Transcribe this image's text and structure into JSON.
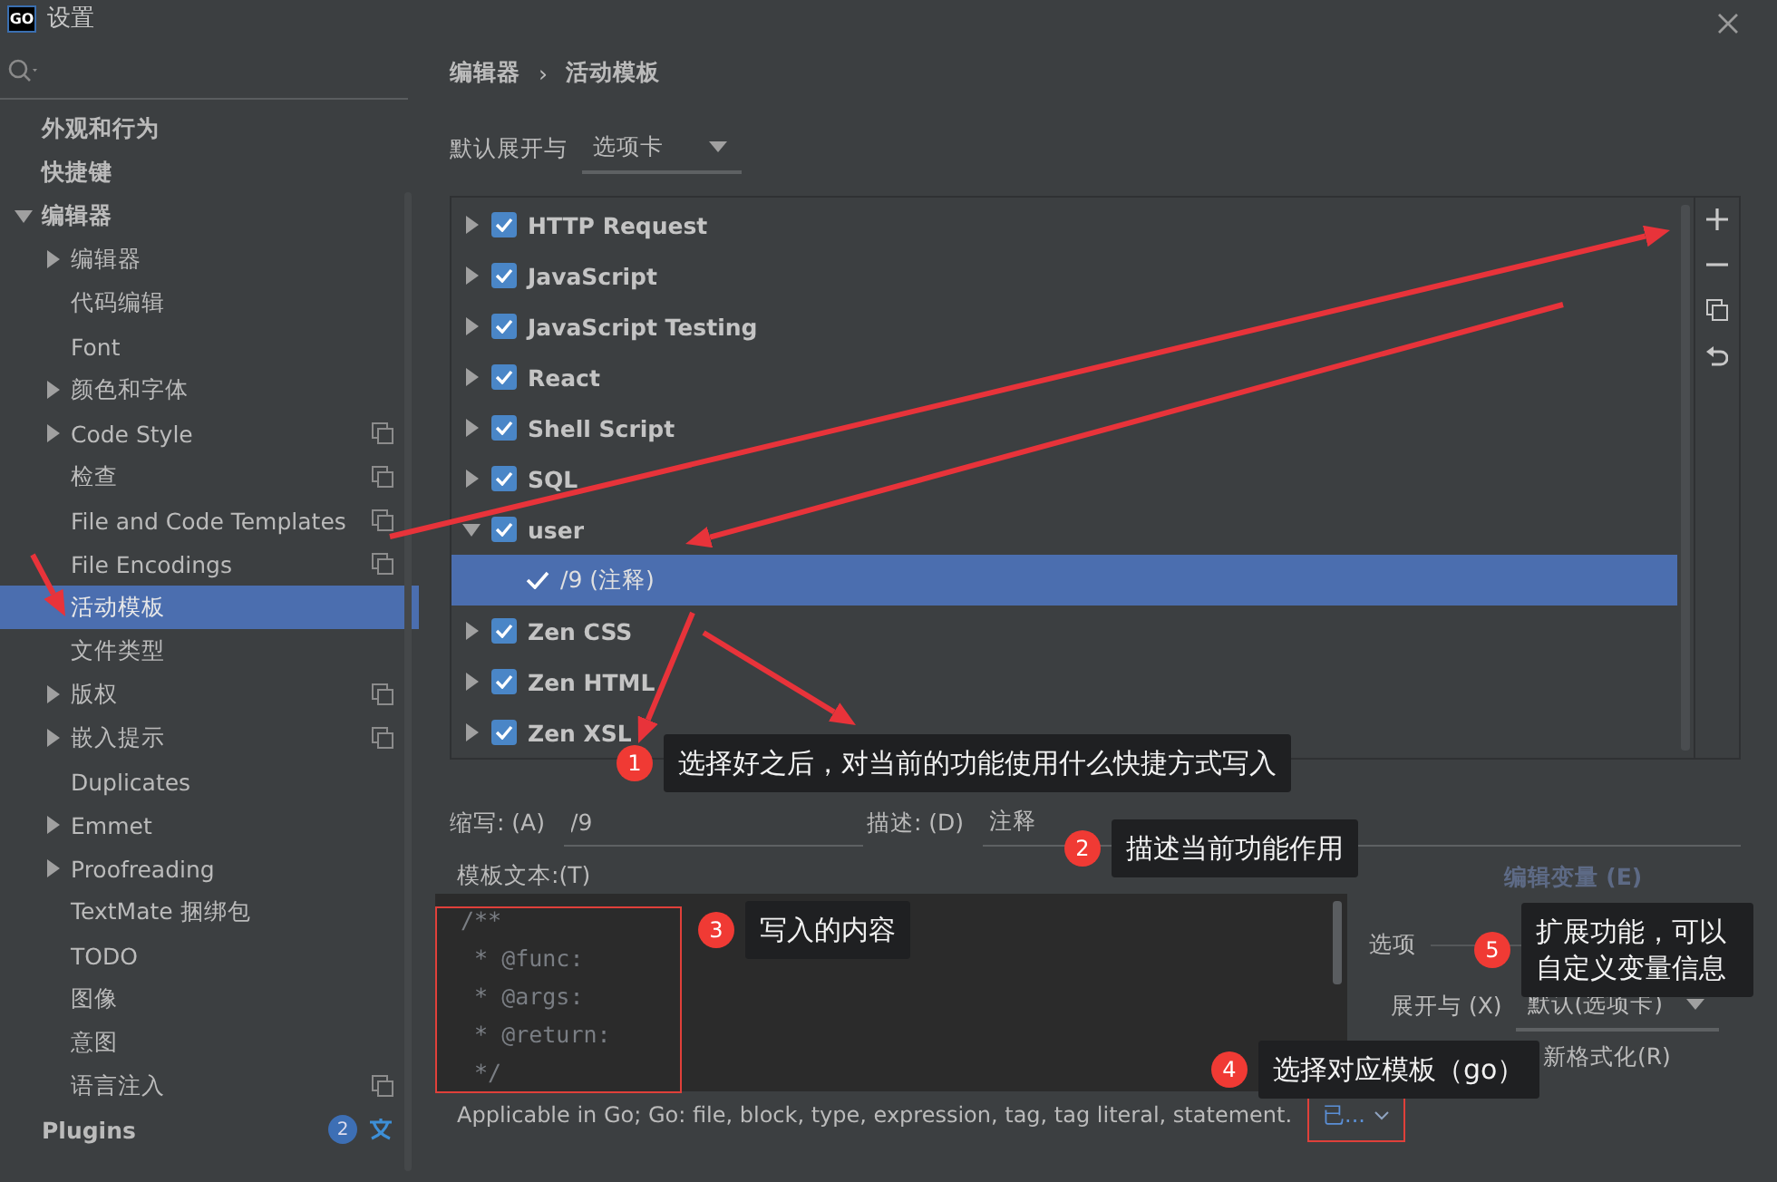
{
  "window": {
    "title": "设置",
    "app_icon_text": "GO"
  },
  "sidebar": {
    "items": [
      {
        "label": "外观和行为",
        "selected": false
      },
      {
        "label": "快捷键",
        "selected": false
      },
      {
        "label": "编辑器",
        "selected": false,
        "expanded": true,
        "children": [
          {
            "label": "编辑器",
            "expanded": false,
            "selected": false
          },
          {
            "label": "代码编辑",
            "selected": false
          },
          {
            "label": "Font",
            "selected": false
          },
          {
            "label": "颜色和字体",
            "expanded": false,
            "selected": false
          },
          {
            "label": "Code Style",
            "expanded": false,
            "project_scoped": true,
            "selected": false
          },
          {
            "label": "检查",
            "project_scoped": true,
            "selected": false
          },
          {
            "label": "File and Code Templates",
            "project_scoped": true,
            "selected": false
          },
          {
            "label": "File Encodings",
            "project_scoped": true,
            "selected": false
          },
          {
            "label": "活动模板",
            "selected": true
          },
          {
            "label": "文件类型",
            "selected": false
          },
          {
            "label": "版权",
            "expanded": false,
            "project_scoped": true,
            "selected": false
          },
          {
            "label": "嵌入提示",
            "expanded": false,
            "project_scoped": true,
            "selected": false
          },
          {
            "label": "Duplicates",
            "selected": false
          },
          {
            "label": "Emmet",
            "expanded": false,
            "selected": false
          },
          {
            "label": "Proofreading",
            "expanded": false,
            "selected": false
          },
          {
            "label": "TextMate 捆绑包",
            "selected": false
          },
          {
            "label": "TODO",
            "selected": false
          },
          {
            "label": "图像",
            "selected": false
          },
          {
            "label": "意图",
            "selected": false
          },
          {
            "label": "语言注入",
            "project_scoped": true,
            "selected": false
          }
        ]
      },
      {
        "label": "Plugins",
        "selected": false,
        "badge": "2",
        "translate_icon": true
      }
    ]
  },
  "breadcrumb": {
    "items": [
      "编辑器",
      "活动模板"
    ],
    "separator": "›"
  },
  "expand_with": {
    "label": "默认展开与",
    "value": "选项卡"
  },
  "template_groups": [
    {
      "name": "HTTP Request",
      "checked": true,
      "expanded": false,
      "selected": false
    },
    {
      "name": "JavaScript",
      "checked": true,
      "expanded": false,
      "selected": false
    },
    {
      "name": "JavaScript Testing",
      "checked": true,
      "expanded": false,
      "selected": false
    },
    {
      "name": "React",
      "checked": true,
      "expanded": false,
      "selected": false
    },
    {
      "name": "Shell Script",
      "checked": true,
      "expanded": false,
      "selected": false
    },
    {
      "name": "SQL",
      "checked": true,
      "expanded": false,
      "selected": false
    },
    {
      "name": "user",
      "checked": true,
      "expanded": true,
      "selected": false,
      "children": [
        {
          "name": "/9 (注释)",
          "checked": true,
          "selected": true
        }
      ]
    },
    {
      "name": "Zen CSS",
      "checked": true,
      "expanded": false,
      "selected": false
    },
    {
      "name": "Zen HTML",
      "checked": true,
      "expanded": false,
      "selected": false
    },
    {
      "name": "Zen XSL",
      "checked": true,
      "expanded": false,
      "selected": false
    }
  ],
  "abbreviation": {
    "label": "缩写: (A)",
    "value": "/9"
  },
  "description": {
    "label": "描述: (D)",
    "value": "注释"
  },
  "template_text": {
    "label": "模板文本:(T)",
    "lines": [
      "/**",
      " * @func:",
      " * @args:",
      " * @return:",
      " */"
    ]
  },
  "edit_variables": {
    "label": "编辑变量 (E)",
    "disabled": true
  },
  "options": {
    "title": "选项",
    "expand_with": {
      "label": "展开与 (X)",
      "value": "默认(选项卡)"
    },
    "reformat": {
      "label": "新格式化(R)"
    }
  },
  "applicable": {
    "text": "Applicable in Go; Go: file, block, type, expression, tag, tag literal, statement.",
    "link": "已..."
  },
  "annotations": [
    {
      "number": "1",
      "text": "选择好之后，对当前的功能使用什么快捷方式写入"
    },
    {
      "number": "2",
      "text": "描述当前功能作用"
    },
    {
      "number": "3",
      "text": "写入的内容"
    },
    {
      "number": "4",
      "text": "选择对应模板（go）"
    },
    {
      "number": "5",
      "text": "扩展功能，可以自定义变量信息"
    }
  ]
}
